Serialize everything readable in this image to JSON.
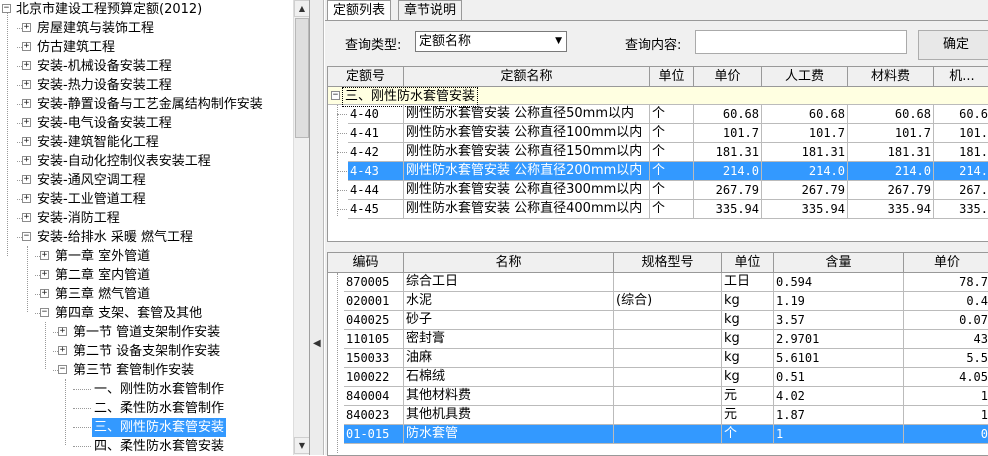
{
  "tree": {
    "root": "北京市建设工程预算定额(2012)",
    "items": [
      {
        "label": "房屋建筑与装饰工程",
        "expand": "+"
      },
      {
        "label": "仿古建筑工程",
        "expand": "+"
      },
      {
        "label": "安装-机械设备安装工程",
        "expand": "+"
      },
      {
        "label": "安装-热力设备安装工程",
        "expand": "+"
      },
      {
        "label": "安装-静置设备与工艺金属结构制作安装",
        "expand": "+"
      },
      {
        "label": "安装-电气设备安装工程",
        "expand": "+"
      },
      {
        "label": "安装-建筑智能化工程",
        "expand": "+"
      },
      {
        "label": "安装-自动化控制仪表安装工程",
        "expand": "+"
      },
      {
        "label": "安装-通风空调工程",
        "expand": "+"
      },
      {
        "label": "安装-工业管道工程",
        "expand": "+"
      },
      {
        "label": "安装-消防工程",
        "expand": "+"
      },
      {
        "label": "安装-给排水 采暖 燃气工程",
        "expand": "−"
      }
    ],
    "chapters": [
      {
        "label": "第一章 室外管道",
        "expand": "+"
      },
      {
        "label": "第二章 室内管道",
        "expand": "+"
      },
      {
        "label": "第三章 燃气管道",
        "expand": "+"
      },
      {
        "label": "第四章 支架、套管及其他",
        "expand": "−"
      }
    ],
    "sections": [
      {
        "label": "第一节 管道支架制作安装",
        "expand": "+"
      },
      {
        "label": "第二节 设备支架制作安装",
        "expand": "+"
      },
      {
        "label": "第三节 套管制作安装",
        "expand": "−"
      }
    ],
    "leaves": [
      {
        "label": "一、刚性防水套管制作"
      },
      {
        "label": "二、柔性防水套管制作"
      },
      {
        "label": "三、刚性防水套管安装"
      },
      {
        "label": "四、柔性防水套管安装"
      }
    ]
  },
  "tabs": [
    "定额列表",
    "章节说明"
  ],
  "query": {
    "type_label": "查询类型:",
    "type_value": "定额名称",
    "content_label": "查询内容:",
    "content_value": "",
    "ok": "确定"
  },
  "quota": {
    "headers": [
      "定额号",
      "定额名称",
      "单位",
      "单价",
      "人工费",
      "材料费",
      "机..."
    ],
    "group": "三、刚性防水套管安装",
    "rows": [
      {
        "code": "4-40",
        "name": "刚性防水套管安装 公称直径50mm以内",
        "unit": "个",
        "price": "60.68",
        "labor": "60.68",
        "material": "60.68",
        "mach": "60.6"
      },
      {
        "code": "4-41",
        "name": "刚性防水套管安装 公称直径100mm以内",
        "unit": "个",
        "price": "101.7",
        "labor": "101.7",
        "material": "101.7",
        "mach": "101."
      },
      {
        "code": "4-42",
        "name": "刚性防水套管安装 公称直径150mm以内",
        "unit": "个",
        "price": "181.31",
        "labor": "181.31",
        "material": "181.31",
        "mach": "181."
      },
      {
        "code": "4-43",
        "name": "刚性防水套管安装 公称直径200mm以内",
        "unit": "个",
        "price": "214.0",
        "labor": "214.0",
        "material": "214.0",
        "mach": "214."
      },
      {
        "code": "4-44",
        "name": "刚性防水套管安装 公称直径300mm以内",
        "unit": "个",
        "price": "267.79",
        "labor": "267.79",
        "material": "267.79",
        "mach": "267."
      },
      {
        "code": "4-45",
        "name": "刚性防水套管安装 公称直径400mm以内",
        "unit": "个",
        "price": "335.94",
        "labor": "335.94",
        "material": "335.94",
        "mach": "335."
      }
    ]
  },
  "resource": {
    "headers": [
      "编码",
      "名称",
      "规格型号",
      "单位",
      "含量",
      "单价"
    ],
    "rows": [
      {
        "code": "870005",
        "name": "综合工日",
        "spec": "",
        "unit": "工日",
        "qty": "0.594",
        "price": "78.7"
      },
      {
        "code": "020001",
        "name": "水泥",
        "spec": "(综合)",
        "unit": "kg",
        "qty": "1.19",
        "price": "0.4"
      },
      {
        "code": "040025",
        "name": "砂子",
        "spec": "",
        "unit": "kg",
        "qty": "3.57",
        "price": "0.07"
      },
      {
        "code": "110105",
        "name": "密封膏",
        "spec": "",
        "unit": "kg",
        "qty": "2.9701",
        "price": "43"
      },
      {
        "code": "150033",
        "name": "油麻",
        "spec": "",
        "unit": "kg",
        "qty": "5.6101",
        "price": "5.5"
      },
      {
        "code": "100022",
        "name": "石棉绒",
        "spec": "",
        "unit": "kg",
        "qty": "0.51",
        "price": "4.05"
      },
      {
        "code": "840004",
        "name": "其他材料费",
        "spec": "",
        "unit": "元",
        "qty": "4.02",
        "price": "1"
      },
      {
        "code": "840023",
        "name": "其他机具费",
        "spec": "",
        "unit": "元",
        "qty": "1.87",
        "price": "1"
      },
      {
        "code": "01-015",
        "name": "防水套管",
        "spec": "",
        "unit": "个",
        "qty": "1",
        "price": "0"
      }
    ]
  },
  "colors": {
    "selection": "#3399ff",
    "group_bg": "#ffffe1"
  }
}
